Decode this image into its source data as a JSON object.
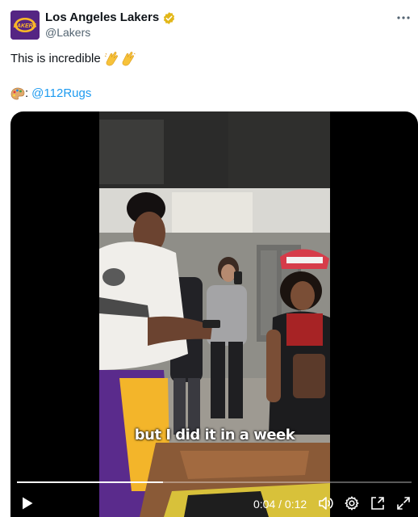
{
  "account": {
    "name": "Los Angeles Lakers",
    "handle": "@Lakers",
    "avatar_text": "LAKERS",
    "brand_color": "#552583",
    "accent_color": "#fdb927"
  },
  "tweet": {
    "text": "This is incredible",
    "text_emoji": "clapping-hands-emoji x2",
    "credit_emoji": "artist-palette-emoji",
    "credit_sep": ":",
    "credit_link": "@112Rugs"
  },
  "video": {
    "caption": "but I did it in a week",
    "time_current": "0:04",
    "time_sep": "/",
    "time_total": "0:12",
    "progress_fraction": 0.37
  },
  "colors": {
    "link": "#1d9bf0",
    "muted": "#536471",
    "verified": "#e2b719"
  }
}
